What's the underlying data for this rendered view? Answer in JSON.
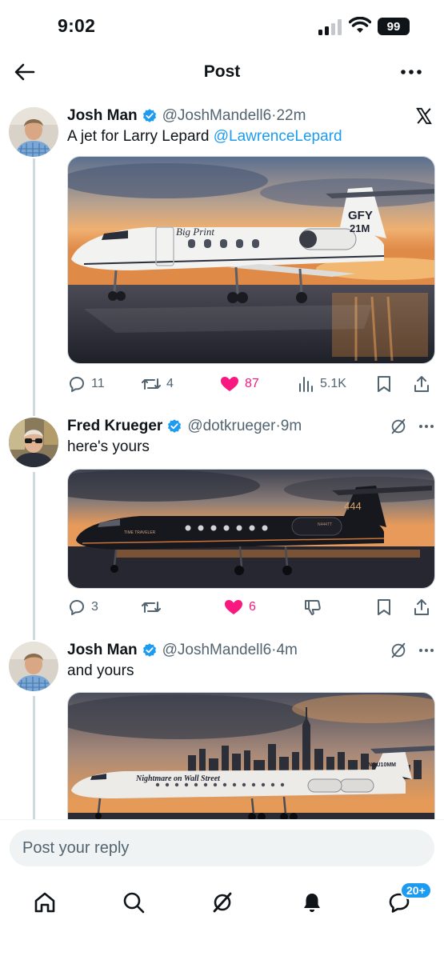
{
  "status_bar": {
    "time": "9:02",
    "battery": "99"
  },
  "header": {
    "title": "Post"
  },
  "tweets": [
    {
      "name": "Josh Man",
      "handle": "@JoshMandell6",
      "sep": " · ",
      "time": "22m",
      "text": "A jet for Larry Lepard ",
      "mention": "@LawrenceLepard",
      "media": {
        "tail": "GFY",
        "tail2": "21M",
        "script": "Big Print"
      },
      "corner_icon": "x-logo-icon",
      "actions": {
        "replies": "11",
        "reposts": "4",
        "likes": "87",
        "views": "5.1K"
      }
    },
    {
      "name": "Fred Krueger",
      "handle": "@dotkrueger",
      "sep": " · ",
      "time": "9m",
      "text": "here's yours",
      "media": {
        "tail": "444",
        "script": "TIME TRAVELER",
        "reg": "N444TT"
      },
      "actions": {
        "replies": "3",
        "reposts": "",
        "likes": "6"
      }
    },
    {
      "name": "Josh Man",
      "handle": "@JoshMandell6",
      "sep": " · ",
      "time": "4m",
      "text": "and yours",
      "media": {
        "script": "Nightmare on Wall Street",
        "reg": "NGU10MM"
      }
    }
  ],
  "composer": {
    "placeholder": "Post your reply"
  },
  "nav": {
    "badge": "20+"
  },
  "colors": {
    "accent": "#1d9bf0",
    "like": "#f91880",
    "muted": "#536471"
  }
}
